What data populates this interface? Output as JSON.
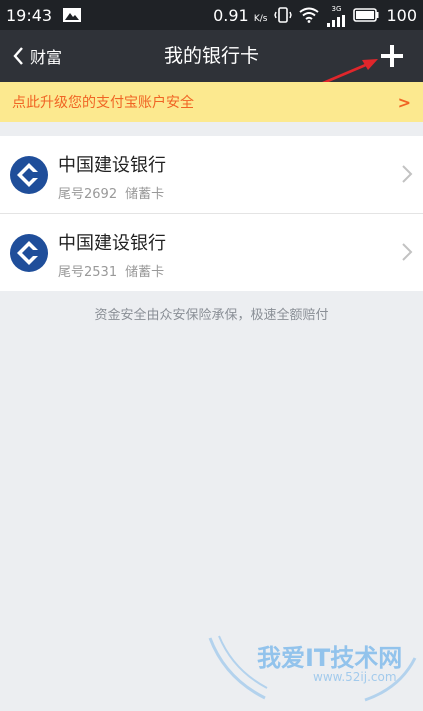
{
  "status_bar": {
    "time": "19:43",
    "speed_value": "0.91",
    "speed_unit": "K/s",
    "network": "3G",
    "battery": "100"
  },
  "header": {
    "back_label": "财富",
    "title": "我的银行卡"
  },
  "banner": {
    "text": "点此升级您的支付宝账户安全",
    "arrow": ">"
  },
  "cards": [
    {
      "bank": "中国建设银行",
      "tail": "尾号2692",
      "type": "储蓄卡",
      "logo_icon": "ccb-bank-logo-icon"
    },
    {
      "bank": "中国建设银行",
      "tail": "尾号2531",
      "type": "储蓄卡",
      "logo_icon": "ccb-bank-logo-icon"
    }
  ],
  "footer_note": "资金安全由众安保险承保，极速全额赔付",
  "watermark": {
    "text": "我爱IT技术网",
    "url": "www.52ij.com"
  },
  "colors": {
    "status_bar_bg": "#1f2226",
    "title_bar_bg": "#2f3238",
    "banner_bg": "#fce98f",
    "banner_text": "#f06424",
    "bank_logo_blue": "#1f4e9a",
    "page_bg": "#eceef1"
  }
}
